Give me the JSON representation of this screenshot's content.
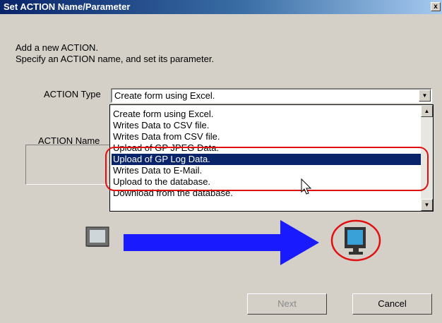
{
  "window": {
    "title": "Set ACTION Name/Parameter",
    "close_label": "x"
  },
  "intro": {
    "line1": "Add a new ACTION.",
    "line2": "Specify an ACTION name, and set its parameter."
  },
  "action_type": {
    "label": "ACTION Type",
    "value": "Create form using Excel."
  },
  "action_name": {
    "label": "ACTION Name"
  },
  "dropdown": {
    "items": [
      "Create form using Excel.",
      "Writes Data to CSV file.",
      "Writes Data from CSV file.",
      "Upload of GP JPEG Data.",
      "Upload of GP Log Data.",
      "Writes Data to E-Mail.",
      "Upload to the database.",
      "Download from the database."
    ],
    "selected_item": "Upload of GP Log Data."
  },
  "buttons": {
    "next": "Next",
    "cancel": "Cancel"
  },
  "colors": {
    "highlight_ring": "#e01010",
    "selection": "#0a246a",
    "arrow": "#1a1aff",
    "window_bg": "#d4d0c8"
  }
}
